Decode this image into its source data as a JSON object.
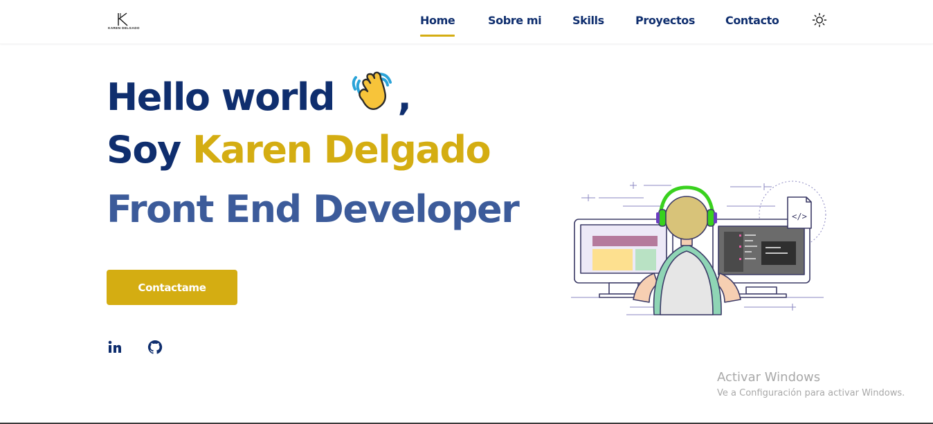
{
  "logo": {
    "letter": "K",
    "text": "KAREN DELGADO"
  },
  "nav": {
    "items": [
      {
        "label": "Home",
        "active": true
      },
      {
        "label": "Sobre mi",
        "active": false
      },
      {
        "label": "Skills",
        "active": false
      },
      {
        "label": "Proyectos",
        "active": false
      },
      {
        "label": "Contacto",
        "active": false
      }
    ],
    "theme_icon": "sun-icon"
  },
  "hero": {
    "line1": "Hello world",
    "line1_suffix": ",",
    "wave_icon": "waving-hand-icon",
    "line2_prefix": "Soy",
    "line2_name": "Karen Delgado",
    "line3": "Front End Developer",
    "cta_label": "Contactame"
  },
  "social": [
    {
      "icon": "linkedin-icon",
      "label": "in"
    },
    {
      "icon": "github-icon"
    }
  ],
  "illustration_icon": "developer-at-desk-icon",
  "code_symbol": "</>",
  "windows_watermark": {
    "title": "Activar Windows",
    "subtitle": "Ve a Configuración para activar Windows."
  },
  "colors": {
    "navy": "#0f2e6e",
    "accent": "#d4ad12",
    "role": "#3c5b9a",
    "watermark": "#a8a8a8"
  }
}
